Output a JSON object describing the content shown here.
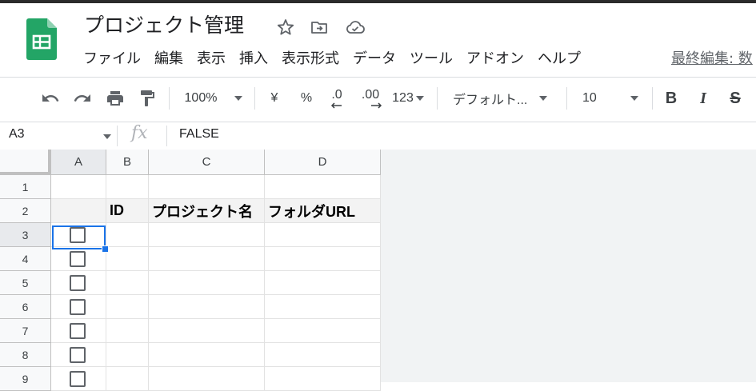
{
  "app": {
    "title": "プロジェクト管理",
    "title_icons": [
      "star-icon",
      "move-to-folder-icon",
      "cloud-saved-icon"
    ],
    "logo_icon": "google-sheets-logo",
    "menu": [
      "ファイル",
      "編集",
      "表示",
      "挿入",
      "表示形式",
      "データ",
      "ツール",
      "アドオン",
      "ヘルプ"
    ],
    "last_edit": "最終編集: 数"
  },
  "toolbar": {
    "undo_icon": "undo-icon",
    "redo_icon": "redo-icon",
    "print_icon": "print-icon",
    "paint_format_icon": "paint-format-icon",
    "zoom": "100%",
    "currency": "¥",
    "percent": "%",
    "decrease_decimal": ".0",
    "increase_decimal": ".00",
    "number_format": "123",
    "font": "デフォルト...",
    "font_size": "10",
    "bold": "B",
    "italic": "I",
    "strikethrough": "S"
  },
  "formula_bar": {
    "cell_ref": "A3",
    "fx_label": "fx",
    "value": "FALSE"
  },
  "sheet": {
    "columns": [
      "A",
      "B",
      "C",
      "D"
    ],
    "rows": [
      "1",
      "2",
      "3",
      "4",
      "5",
      "6",
      "7",
      "8",
      "9"
    ],
    "header_cells": {
      "B2": "ID",
      "C2": "プロジェクト名",
      "D2": "フォルダURL"
    },
    "checkbox_rows": [
      "3",
      "4",
      "5",
      "6",
      "7",
      "8",
      "9"
    ],
    "selected_cell": "A3",
    "selection_color": "#1a73e8"
  },
  "colors": {
    "sheets_green": "#23a566",
    "selection": "#1a73e8"
  }
}
